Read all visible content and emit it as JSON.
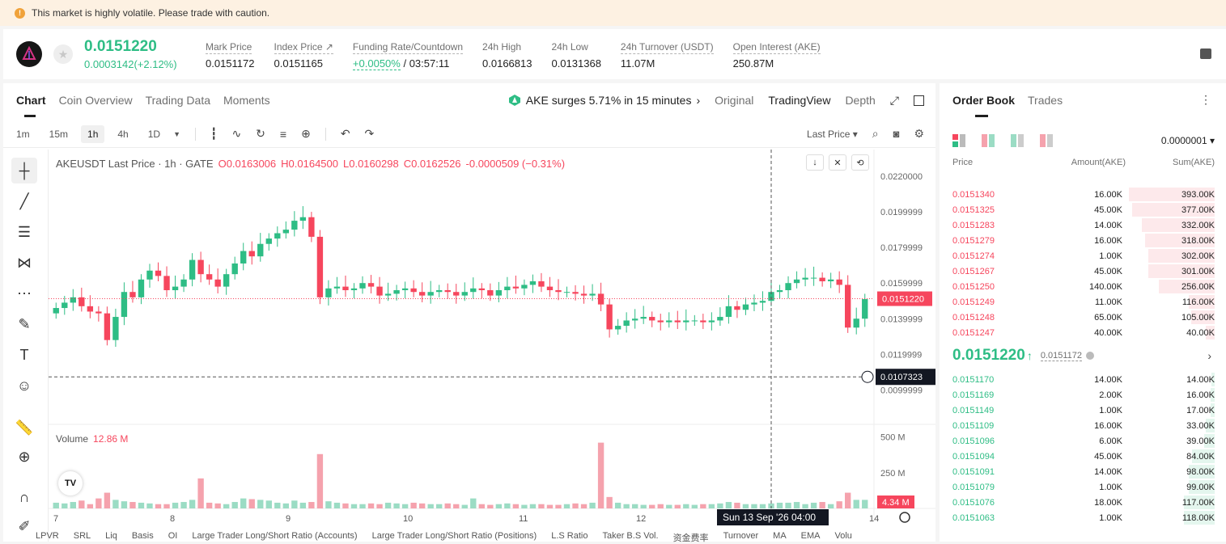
{
  "banner": {
    "text": "This market is highly volatile. Please trade with caution."
  },
  "ticker": {
    "price": "0.0151220",
    "change": "0.0003142(+2.12%)",
    "stats": [
      {
        "label": "Mark Price",
        "value": "0.0151172"
      },
      {
        "label": "Index Price ↗",
        "value": "0.0151165"
      },
      {
        "label": "Funding Rate/Countdown",
        "value_rate": "+0.0050%",
        "value_countdown": "/ 03:57:11"
      },
      {
        "label": "24h High",
        "value": "0.0166813"
      },
      {
        "label": "24h Low",
        "value": "0.0131368"
      },
      {
        "label": "24h Turnover (USDT)",
        "value": "11.07M"
      },
      {
        "label": "Open Interest (AKE)",
        "value": "250.87M"
      }
    ]
  },
  "tabs": [
    "Chart",
    "Coin Overview",
    "Trading Data",
    "Moments"
  ],
  "surge": "AKE surges 5.71% in 15 minutes",
  "views": [
    "Original",
    "TradingView",
    "Depth"
  ],
  "toolbar": {
    "timeframes": [
      "1m",
      "15m",
      "1h",
      "4h",
      "1D"
    ],
    "active_timeframe": "1h",
    "price_type": "Last Price"
  },
  "legend": {
    "symbol": "AKEUSDT Last Price · 1h · GATE",
    "open": "O0.0163006",
    "high": "H0.0164500",
    "low": "L0.0160298",
    "close": "C0.0162526",
    "change": "-0.0000509 (−0.31%)"
  },
  "volume": {
    "label": "Volume",
    "value": "12.86 M",
    "last_badge": "4.34 M"
  },
  "crosshair": {
    "price": "0.0107323",
    "time": "Sun 13 Sep '26   04:00"
  },
  "last_price_badge": "0.0151220",
  "indicators": [
    "LPVR",
    "SRL",
    "Liq",
    "Basis",
    "OI",
    "Large Trader Long/Short Ratio (Accounts)",
    "Large Trader Long/Short Ratio (Positions)",
    "L.S Ratio",
    "Taker B.S Vol.",
    "资金费率",
    "Turnover",
    "MA",
    "EMA",
    "Volu"
  ],
  "chart_data": {
    "type": "candlestick",
    "title": "AKEUSDT Last Price · 1h · GATE",
    "price_axis_ticks": [
      "0.0220000",
      "0.0199999",
      "0.0179999",
      "0.0159999",
      "0.0139999",
      "0.0119999",
      "0.0099999"
    ],
    "volume_axis_ticks": [
      "500 M",
      "250 M"
    ],
    "x_ticks": [
      "7",
      "8",
      "9",
      "10",
      "11",
      "12",
      "14"
    ],
    "ylim": [
      0.0092,
      0.0225
    ],
    "close_series": [
      0.0146,
      0.0149,
      0.0152,
      0.0147,
      0.0144,
      0.0143,
      0.0128,
      0.0141,
      0.0155,
      0.0152,
      0.0162,
      0.0167,
      0.0164,
      0.0156,
      0.0158,
      0.0162,
      0.0173,
      0.0165,
      0.0162,
      0.0158,
      0.0165,
      0.0171,
      0.0178,
      0.0175,
      0.0182,
      0.0185,
      0.0188,
      0.019,
      0.0195,
      0.0197,
      0.0186,
      0.0152,
      0.0157,
      0.0158,
      0.0156,
      0.0157,
      0.016,
      0.0158,
      0.0153,
      0.0154,
      0.0156,
      0.0157,
      0.0155,
      0.0153,
      0.0155,
      0.0156,
      0.0155,
      0.0153,
      0.0155,
      0.0157,
      0.0156,
      0.0153,
      0.0156,
      0.0158,
      0.0157,
      0.0159,
      0.0161,
      0.0158,
      0.0156,
      0.0155,
      0.0155,
      0.0154,
      0.0153,
      0.0154,
      0.0148,
      0.0134,
      0.0136,
      0.0139,
      0.014,
      0.0141,
      0.0139,
      0.0138,
      0.0139,
      0.0138,
      0.0139,
      0.0139,
      0.0138,
      0.0139,
      0.0141,
      0.0147,
      0.0145,
      0.0148,
      0.0149,
      0.015,
      0.0155,
      0.0156,
      0.016,
      0.0162,
      0.0163,
      0.0163,
      0.0161,
      0.0162,
      0.0159,
      0.0135,
      0.014,
      0.0151
    ],
    "volume_series": [
      40,
      35,
      45,
      55,
      30,
      70,
      110,
      60,
      50,
      45,
      40,
      35,
      30,
      30,
      40,
      45,
      60,
      210,
      40,
      35,
      30,
      45,
      70,
      65,
      60,
      55,
      40,
      35,
      55,
      40,
      45,
      380,
      50,
      40,
      35,
      30,
      30,
      35,
      30,
      40,
      35,
      30,
      40,
      35,
      30,
      30,
      35,
      30,
      25,
      70,
      30,
      25,
      30,
      35,
      30,
      25,
      30,
      30,
      25,
      25,
      30,
      35,
      30,
      40,
      460,
      80,
      40,
      30,
      30,
      25,
      25,
      30,
      25,
      25,
      30,
      25,
      30,
      30,
      35,
      45,
      40,
      30,
      30,
      30,
      35,
      40,
      40,
      45,
      30,
      40,
      45,
      30,
      50,
      110,
      60,
      60
    ]
  },
  "orderbook": {
    "tabs": [
      "Order Book",
      "Trades"
    ],
    "precision": "0.0000001",
    "headers": [
      "Price",
      "Amount(AKE)",
      "Sum(AKE)"
    ],
    "asks": [
      {
        "price": "0.0151340",
        "amount": "16.00K",
        "sum": "393.00K",
        "depth": 1.0
      },
      {
        "price": "0.0151325",
        "amount": "45.00K",
        "sum": "377.00K",
        "depth": 0.96
      },
      {
        "price": "0.0151283",
        "amount": "14.00K",
        "sum": "332.00K",
        "depth": 0.85
      },
      {
        "price": "0.0151279",
        "amount": "16.00K",
        "sum": "318.00K",
        "depth": 0.81
      },
      {
        "price": "0.0151274",
        "amount": "1.00K",
        "sum": "302.00K",
        "depth": 0.77
      },
      {
        "price": "0.0151267",
        "amount": "45.00K",
        "sum": "301.00K",
        "depth": 0.77
      },
      {
        "price": "0.0151250",
        "amount": "140.00K",
        "sum": "256.00K",
        "depth": 0.65
      },
      {
        "price": "0.0151249",
        "amount": "11.00K",
        "sum": "116.00K",
        "depth": 0.3
      },
      {
        "price": "0.0151248",
        "amount": "65.00K",
        "sum": "105.00K",
        "depth": 0.27
      },
      {
        "price": "0.0151247",
        "amount": "40.00K",
        "sum": "40.00K",
        "depth": 0.1
      }
    ],
    "last_price": "0.0151220",
    "arrow": "↑",
    "mark_price": "0.0151172",
    "bids": [
      {
        "price": "0.0151170",
        "amount": "14.00K",
        "sum": "14.00K",
        "depth": 0.04
      },
      {
        "price": "0.0151169",
        "amount": "2.00K",
        "sum": "16.00K",
        "depth": 0.05
      },
      {
        "price": "0.0151149",
        "amount": "1.00K",
        "sum": "17.00K",
        "depth": 0.05
      },
      {
        "price": "0.0151109",
        "amount": "16.00K",
        "sum": "33.00K",
        "depth": 0.1
      },
      {
        "price": "0.0151096",
        "amount": "6.00K",
        "sum": "39.00K",
        "depth": 0.12
      },
      {
        "price": "0.0151094",
        "amount": "45.00K",
        "sum": "84.00K",
        "depth": 0.26
      },
      {
        "price": "0.0151091",
        "amount": "14.00K",
        "sum": "98.00K",
        "depth": 0.3
      },
      {
        "price": "0.0151079",
        "amount": "1.00K",
        "sum": "99.00K",
        "depth": 0.3
      },
      {
        "price": "0.0151076",
        "amount": "18.00K",
        "sum": "117.00K",
        "depth": 0.36
      },
      {
        "price": "0.0151063",
        "amount": "1.00K",
        "sum": "118.00K",
        "depth": 0.36
      }
    ]
  },
  "colors": {
    "up": "#2ebd85",
    "down": "#f6465d",
    "up_light": "#9bdcc4",
    "down_light": "#f5a2ad"
  }
}
